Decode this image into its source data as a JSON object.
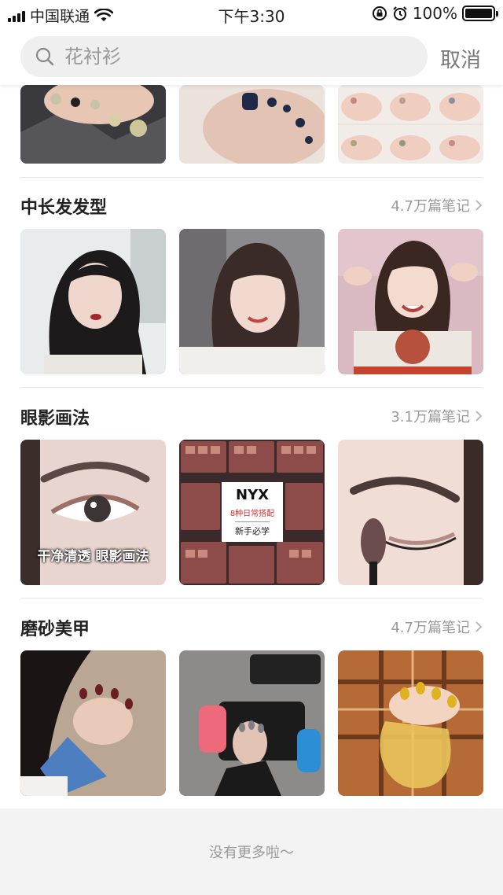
{
  "status_bar": {
    "carrier": "中国联通",
    "time": "下午3:30",
    "battery_percent": "100%",
    "battery_level": 1.0,
    "icons": [
      "signal-icon",
      "wifi-icon",
      "rotation-lock-icon",
      "alarm-icon",
      "battery-icon"
    ]
  },
  "search": {
    "placeholder": "花衬衫",
    "value": "",
    "cancel_label": "取消"
  },
  "sections": [
    {
      "title": "",
      "count": "",
      "images": [
        "toenails-glitter",
        "toenails-navy",
        "toenails-swatches"
      ]
    },
    {
      "title": "中长发发型",
      "count": "4.7万篇笔记",
      "images": [
        "hair-portrait-1",
        "hair-portrait-2",
        "hair-portrait-3"
      ]
    },
    {
      "title": "眼影画法",
      "count": "3.1万篇笔记",
      "images": [
        "eye-closeup",
        "nyx-palettes",
        "eyeshadow-brush"
      ]
    },
    {
      "title": "磨砂美甲",
      "count": "4.7万篇笔记",
      "images": [
        "matte-nails-hand",
        "nails-game-console",
        "nails-perfume-bottle"
      ]
    }
  ],
  "overlays": {
    "eyeshadow_caption": "干净清透 眼影画法",
    "nyx_brand": "NYX",
    "nyx_subtitle": "8种日常搭配",
    "nyx_footer": "新手必学"
  },
  "footer_text": "没有更多啦～",
  "colors": {
    "background": "#f3f3f3",
    "search_box": "#efefef",
    "muted_text": "#999999",
    "accent_red": "#d62b2b"
  }
}
